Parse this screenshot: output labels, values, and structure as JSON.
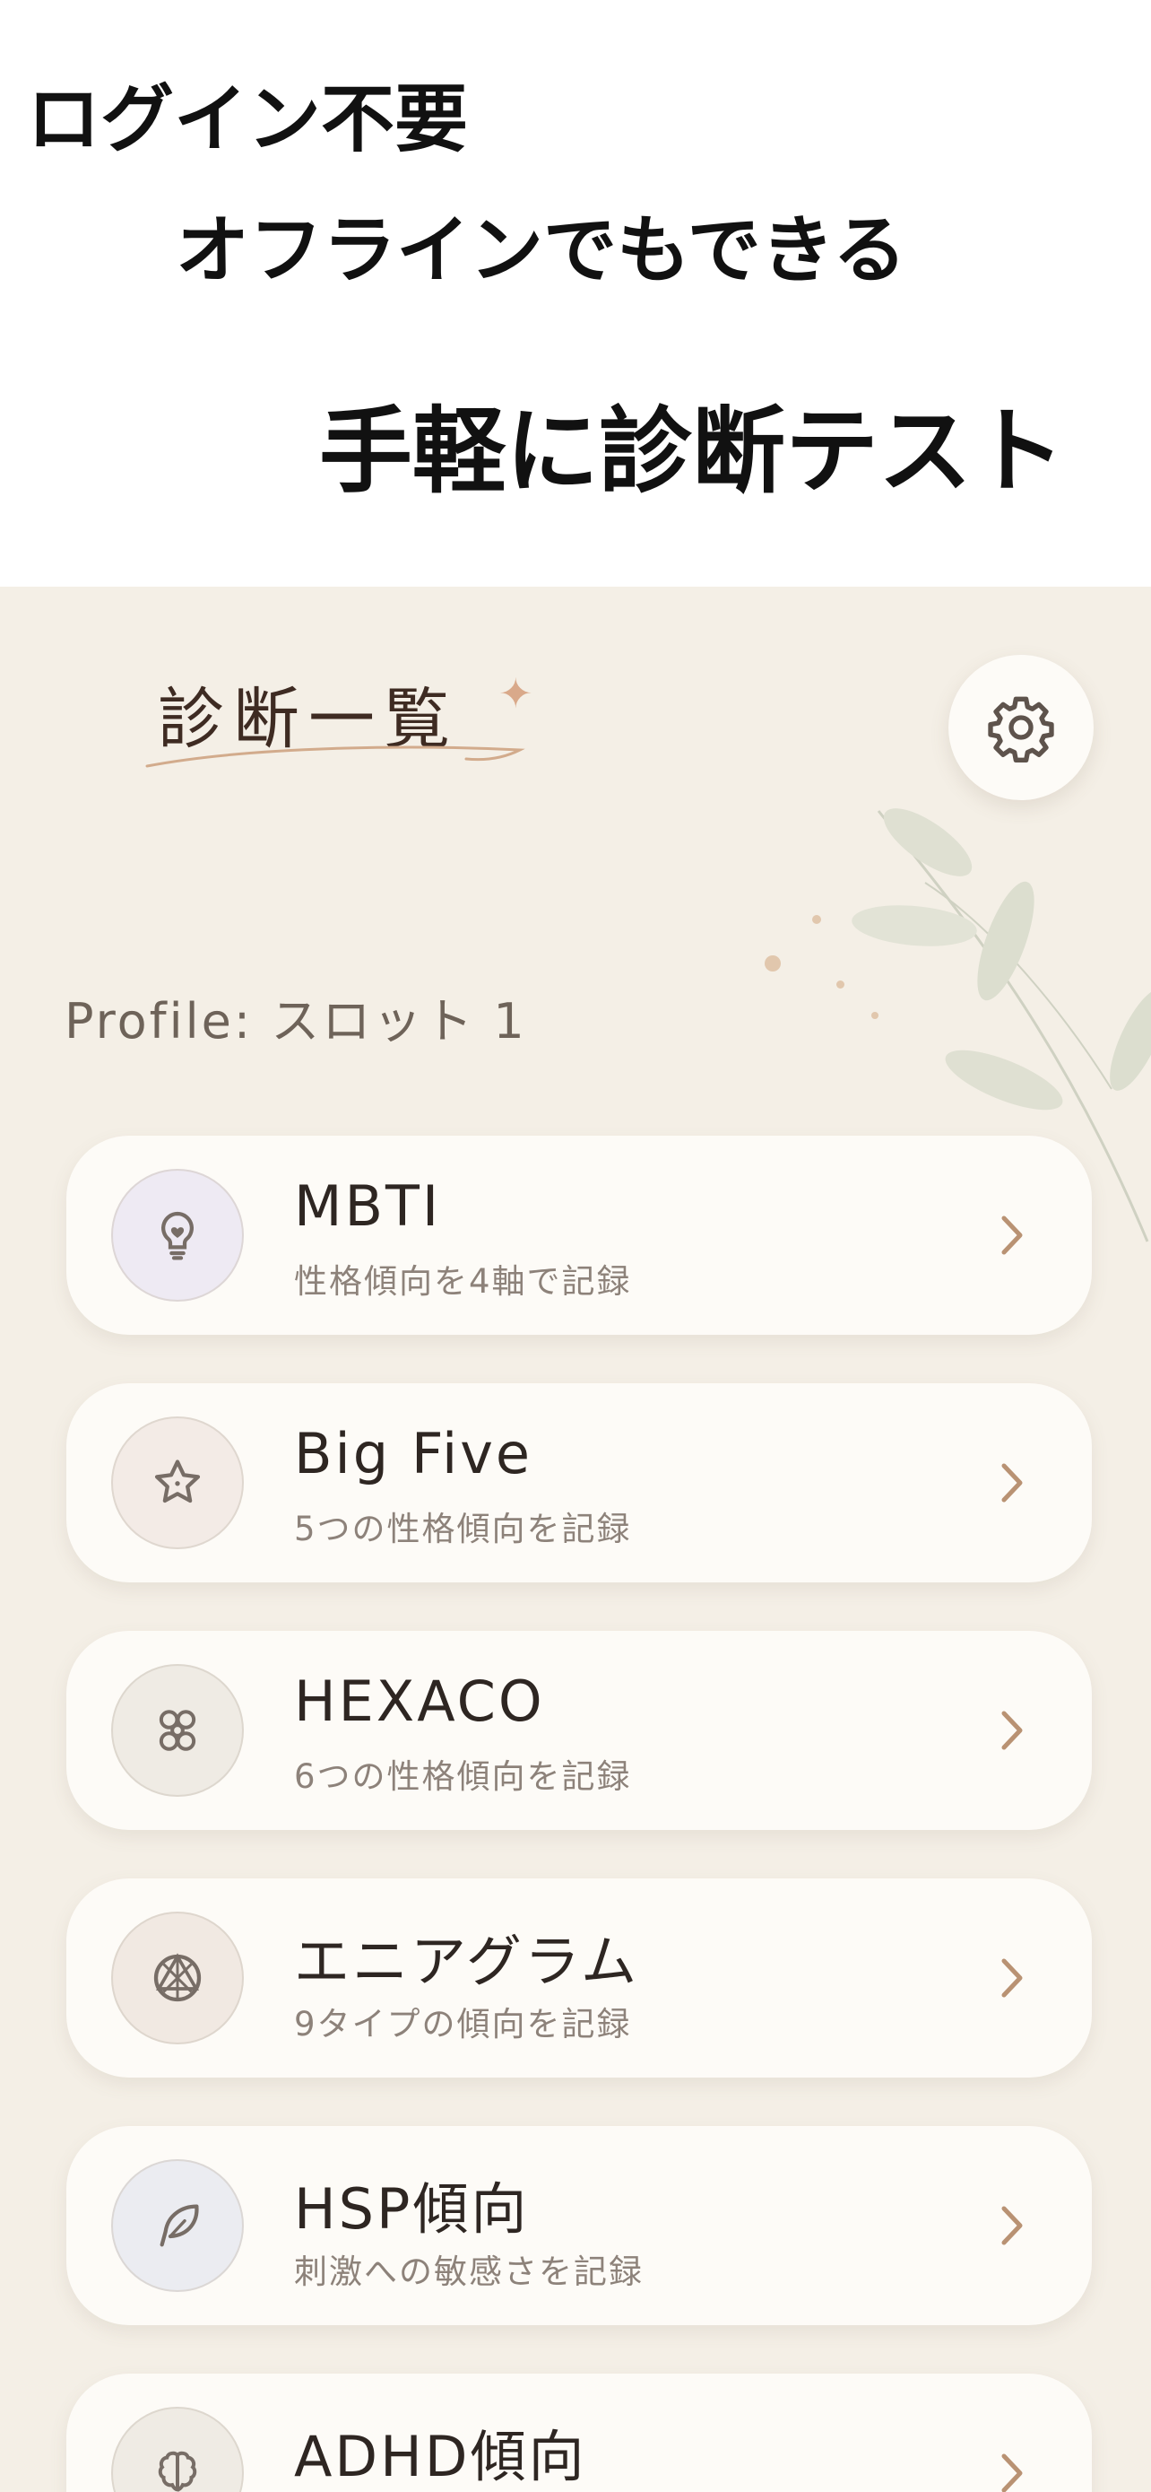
{
  "promo": {
    "line1": "ログイン不要",
    "line2": "オフラインでもできる",
    "line3": "手軽に診断テスト"
  },
  "header": {
    "title": "診断一覧",
    "settings_icon": "gear-icon"
  },
  "profile": {
    "label": "Profile: スロット 1"
  },
  "tests": [
    {
      "name": "MBTI",
      "description": "性格傾向を4軸で記録",
      "icon": "lightbulb-icon",
      "icon_bg": "#eeeaf3"
    },
    {
      "name": "Big Five",
      "description": "5つの性格傾向を記録",
      "icon": "star-icon",
      "icon_bg": "#f3ebe6"
    },
    {
      "name": "HEXACO",
      "description": "6つの性格傾向を記録",
      "icon": "hexagon-cluster-icon",
      "icon_bg": "#efebe4"
    },
    {
      "name": "エニアグラム",
      "description": "9タイプの傾向を記録",
      "icon": "enneagram-icon",
      "icon_bg": "#f1e9e2"
    },
    {
      "name": "HSP傾向",
      "description": "刺激への敏感さを記録",
      "icon": "feather-icon",
      "icon_bg": "#ebecf1"
    },
    {
      "name": "ADHD傾向",
      "description": "",
      "icon": "brain-icon",
      "icon_bg": "#efebe4"
    }
  ],
  "colors": {
    "background": "#f4efe6",
    "card": "#fdfbf7",
    "accent": "#b99273",
    "title": "#3e2b22"
  }
}
